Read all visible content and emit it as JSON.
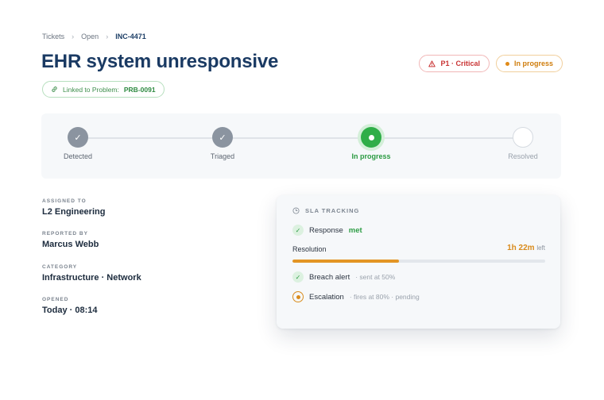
{
  "breadcrumb": {
    "items": [
      "Tickets",
      "Open"
    ],
    "current": "INC-4471"
  },
  "ticket": {
    "title": "EHR system unresponsive"
  },
  "badges": {
    "priority": "P1 · Critical",
    "status": "In progress"
  },
  "linked": {
    "label": "Linked to Problem:",
    "id": "PRB-0091"
  },
  "stepper": {
    "steps": [
      {
        "label": "Detected",
        "state": "done"
      },
      {
        "label": "Triaged",
        "state": "done"
      },
      {
        "label": "In progress",
        "state": "current"
      },
      {
        "label": "Resolved",
        "state": "todo"
      }
    ]
  },
  "details": {
    "assigned": {
      "key": "ASSIGNED TO",
      "value": "L2 Engineering"
    },
    "reported": {
      "key": "REPORTED BY",
      "value": "Marcus Webb"
    },
    "category": {
      "key": "CATEGORY",
      "value": "Infrastructure · Network"
    },
    "opened": {
      "key": "OPENED",
      "value": "Today · 08:14"
    }
  },
  "sla": {
    "heading": "SLA TRACKING",
    "response": {
      "label": "Response",
      "status": "met"
    },
    "resolution": {
      "label": "Resolution",
      "time": "1h 22m",
      "suffix": "left",
      "progress": 0.42
    },
    "breach": {
      "label": "Breach alert",
      "note": "· sent at 50%"
    },
    "escalation": {
      "label": "Escalation",
      "note": "· fires at 80% · pending"
    }
  },
  "colors": {
    "accent_green": "#2fae48",
    "warning_orange": "#d98b1c",
    "critical_red": "#c93434",
    "title_navy": "#1a3a63"
  },
  "icons": [
    "chevron-right-icon",
    "alert-triangle-icon",
    "link-icon",
    "check-icon",
    "clock-icon"
  ]
}
